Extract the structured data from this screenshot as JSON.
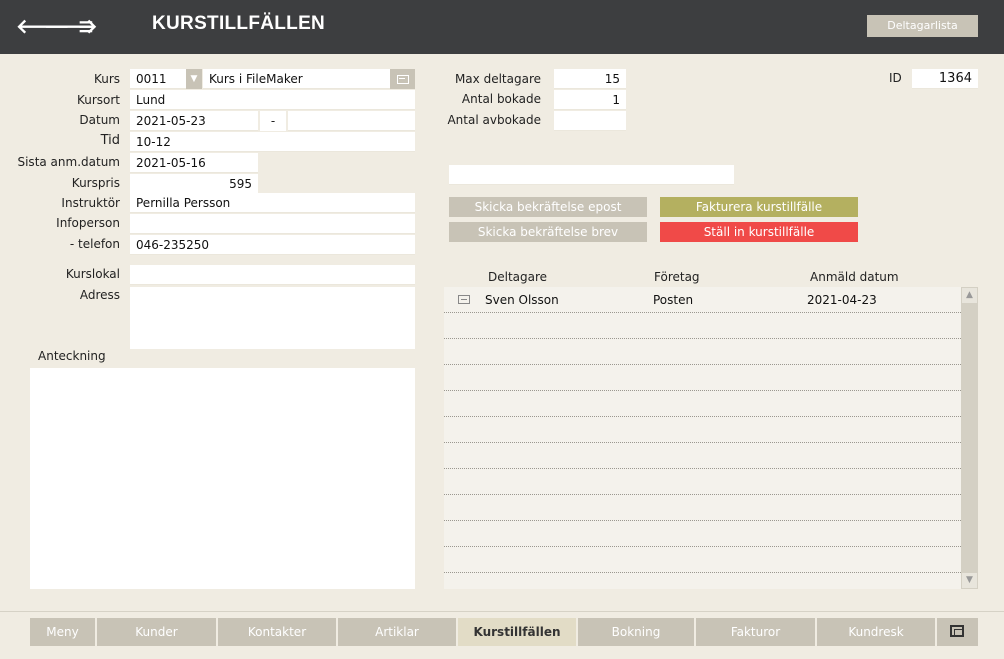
{
  "header": {
    "title": "KURSTILLFÄLLEN",
    "participant_list_button": "Deltagarlista",
    "back_symbol": "🡐",
    "forward_symbol": "🡒",
    "menu_symbol": "≡"
  },
  "form": {
    "kurs_label": "Kurs",
    "kurs_code": "0011",
    "kurs_name": "Kurs i FileMaker",
    "kursort_label": "Kursort",
    "kursort": "Lund",
    "datum_label": "Datum",
    "datum": "2021-05-23",
    "datum_separator": "-",
    "tid_label": "Tid",
    "tid": "10-12",
    "sista_label": "Sista anm.datum",
    "sista": "2021-05-16",
    "kurspris_label": "Kurspris",
    "kurspris": "595",
    "instruktor_label": "Instruktör",
    "instruktor": "Pernilla Persson",
    "infoperson_label": "Infoperson",
    "infoperson": "",
    "telefon_label": "- telefon",
    "telefon": "046-235250",
    "kurslokal_label": "Kurslokal",
    "kurslokal": "",
    "adress_label": "Adress",
    "anteckning_label": "Anteckning",
    "max_label": "Max deltagare",
    "max": "15",
    "bokade_label": "Antal bokade",
    "bokade": "1",
    "avbokade_label": "Antal avbokade",
    "avbokade": "",
    "id_label": "ID",
    "id": "1364"
  },
  "actions": {
    "email_confirm": "Skicka bekräftelse epost",
    "letter_confirm": "Skicka bekräftelse brev",
    "invoice": "Fakturera kurstillfälle",
    "cancel": "Ställ in kurstillfälle"
  },
  "table": {
    "columns": [
      "Deltagare",
      "Företag",
      "Anmäld datum"
    ],
    "rows": [
      {
        "deltagare": "Sven Olsson",
        "foretag": "Posten",
        "datum": "2021-04-23"
      }
    ]
  },
  "footer": {
    "tabs": [
      "Meny",
      "Kunder",
      "Kontakter",
      "Artiklar",
      "Kurstillfällen",
      "Bokning",
      "Fakturor",
      "Kundresk"
    ],
    "active_tab": "Kurstillfällen"
  },
  "colors": {
    "header_bg": "#3d3e40",
    "page_bg": "#f0ece2",
    "button_grey": "#c8c3b6",
    "button_olive": "#b4b060",
    "button_red": "#f04a48"
  }
}
